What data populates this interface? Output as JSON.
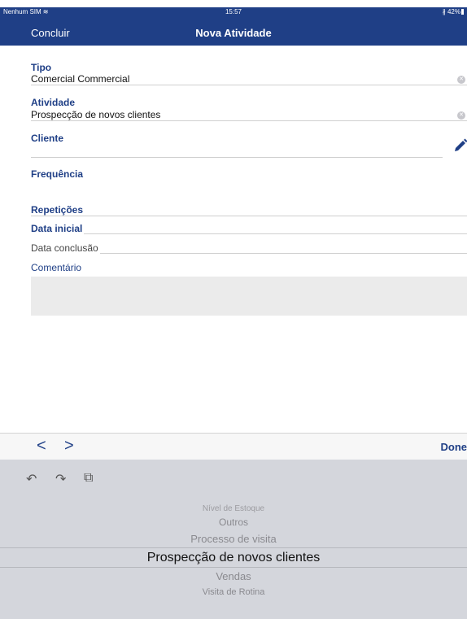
{
  "status_bar": {
    "carrier": "Nenhum SIM",
    "time": "15:57",
    "battery": "42%"
  },
  "nav": {
    "back_label": "Concluir",
    "title": "Nova Atividade"
  },
  "form": {
    "tipo": {
      "label": "Tipo",
      "value": "Comercial Commercial"
    },
    "atividade": {
      "label": "Atividade",
      "value": "Prospecção de novos clientes"
    },
    "cliente": {
      "label": "Cliente",
      "value": ""
    },
    "frequencia": {
      "label": "Frequência"
    },
    "repeticoes": {
      "label": "Repetições"
    },
    "data_inicial": {
      "label": "Data inicial"
    },
    "data_conclusao": {
      "label": "Data conclusão"
    },
    "comentario": {
      "label": "Comentário",
      "value": ""
    }
  },
  "accessory": {
    "prev": "<",
    "next": ">",
    "done_label": "Done"
  },
  "shortcuts": {
    "undo": "↶",
    "redo": "↷",
    "paste": "⧉"
  },
  "picker": {
    "options": [
      "Nível de Estoque",
      "Outros",
      "Processo de visita",
      "Prospecção de novos clientes",
      "Vendas",
      "Visita de Rotina"
    ],
    "selected": "Prospecção de novos clientes"
  },
  "colors": {
    "brand": "#1f3f86",
    "picker_bg": "#d4d6dc",
    "comment_bg": "#ebebeb"
  },
  "icons": {
    "wifi": "wifi-icon",
    "bluetooth": "bluetooth-icon",
    "battery": "battery-icon",
    "clear": "clear-icon",
    "edit": "pencil-icon"
  }
}
